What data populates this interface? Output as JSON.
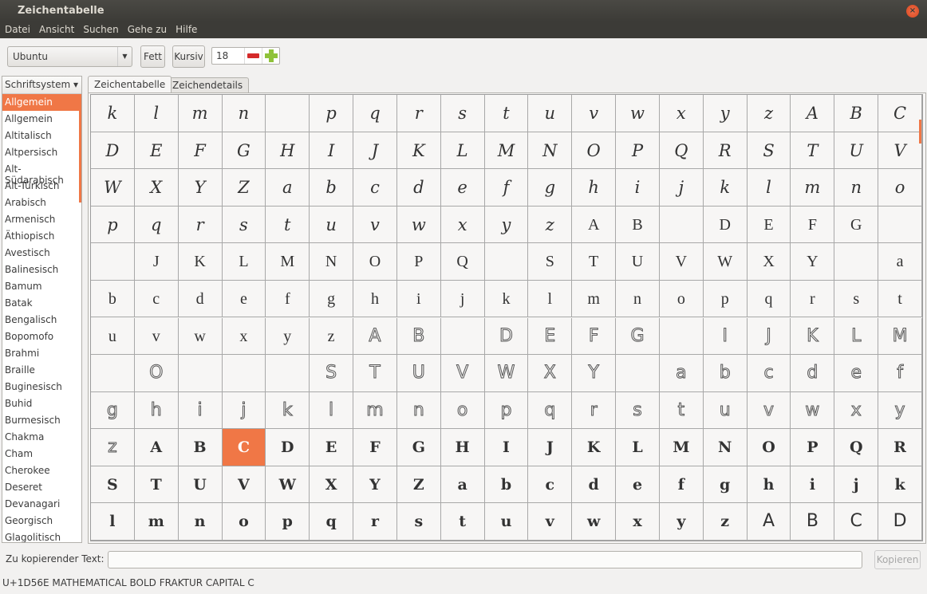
{
  "window": {
    "title": "Zeichentabelle"
  },
  "menu": [
    "Datei",
    "Ansicht",
    "Suchen",
    "Gehe zu",
    "Hilfe"
  ],
  "toolbar": {
    "font": "Ubuntu",
    "bold_label": "Fett",
    "italic_label": "Kursiv",
    "size": "18"
  },
  "sidebar": {
    "header": "Schriftsystem ▾",
    "selected": "Allgemein",
    "items": [
      "Allgemein",
      "Allgemein",
      "Altitalisch",
      "Altpersisch",
      "Alt-Südarabisch",
      "Alt-Türkisch",
      "Arabisch",
      "Armenisch",
      "Äthiopisch",
      "Avestisch",
      "Balinesisch",
      "Bamum",
      "Batak",
      "Bengalisch",
      "Bopomofo",
      "Brahmi",
      "Braille",
      "Buginesisch",
      "Buhid",
      "Burmesisch",
      "Chakma",
      "Cham",
      "Cherokee",
      "Deseret",
      "Devanagari",
      "Georgisch",
      "Glagolitisch"
    ]
  },
  "tabs": [
    "Zeichentabelle",
    "Zeichendetails"
  ],
  "grid": {
    "selected": {
      "row": 9,
      "col": 3
    },
    "rows": [
      {
        "chars": "klmn pqrstuvwxyzABC",
        "styles": "sssssssssssssssssss"
      },
      {
        "chars": "DEFGHIJKLMNOPQRSTUV",
        "styles": "sssssssssssssssssss"
      },
      {
        "chars": "WXYZabcdefghijklmno",
        "styles": "sssssssssssssssssss"
      },
      {
        "chars": "pqrstuvwxyzAB DEFG ",
        "styles": "sssssssssssffffffff"
      },
      {
        "chars": " JKLMNOPQ STUVWXY a",
        "styles": "fffffffffffffffffff"
      },
      {
        "chars": "bcdefghijklmnopqrst",
        "styles": "fffffffffffffffffff"
      },
      {
        "chars": "uvwxyzAB DEFG IJKLM",
        "styles": "ffffffddddddddddddd"
      },
      {
        "chars": " O   STUVWXY abcdef",
        "styles": "ddddddddddddddddddd"
      },
      {
        "chars": "ghijklmnopqrstuvwxy",
        "styles": "ddddddddddddddddddd"
      },
      {
        "chars": "zABCDEFGHIJKLMNOPQR",
        "styles": "dFFFFFFFFFFFFFFFFFF"
      },
      {
        "chars": "STUVWXYZabcdefghijk",
        "styles": "FFFFFFFFFFFFFFFFFFF"
      },
      {
        "chars": "lmnopqrstuvwxyzABCD",
        "styles": "FFFFFFFFFFFFFFFnnnn"
      }
    ]
  },
  "copy": {
    "label": "Zu kopierender Text:",
    "value": "",
    "button": "Kopieren"
  },
  "status": "U+1D56E MATHEMATICAL BOLD FRAKTUR CAPITAL C",
  "colors": {
    "accent": "#f07746",
    "titlebar": "#3c3b37"
  }
}
